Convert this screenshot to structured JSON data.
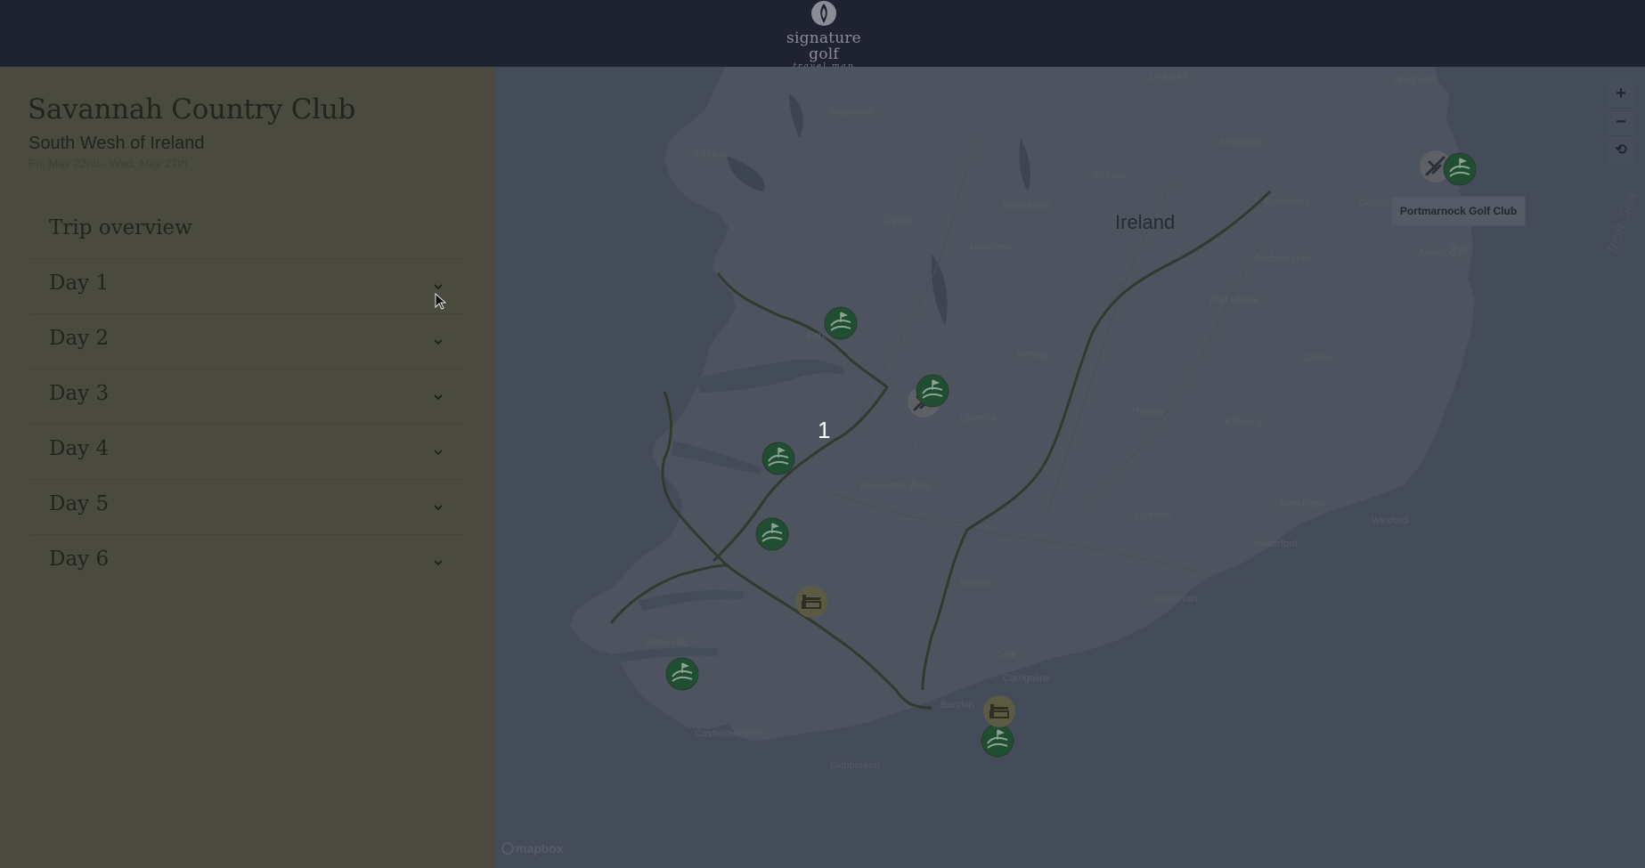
{
  "header": {
    "logo_word": "signature golf",
    "logo_sub": "travel map"
  },
  "sidebar": {
    "trip_title": "Savannah Country Club",
    "region": "South Wesh of Ireland",
    "dates": "Fri, May 22nd - Wed, May 27th",
    "items": [
      {
        "label": "Trip overview"
      },
      {
        "label": "Day 1"
      },
      {
        "label": "Day 2"
      },
      {
        "label": "Day 3"
      },
      {
        "label": "Day 4"
      },
      {
        "label": "Day 5"
      },
      {
        "label": "Day 6"
      }
    ]
  },
  "map": {
    "country_label": "Ireland",
    "cluster_number": "1",
    "tooltip": "Portmarnock Golf Club",
    "attribution": "mapbox",
    "controls": {
      "zoom_in": "+",
      "zoom_out": "−",
      "reset": "⟲"
    },
    "place_labels": [
      "Longford",
      "Drogheda",
      "Ballinrobe",
      "Clifden",
      "Mullingar",
      "Athlone",
      "Ballinasloe",
      "Galway",
      "Loughrea",
      "Edenderry",
      "Celbridge",
      "Portarlington",
      "Newbridge",
      "Bray",
      "Port Laoise",
      "Ennis",
      "Nenagh",
      "Carlow",
      "Limerick",
      "Thurles",
      "Kilkenny",
      "Newcastle West",
      "Clonmel",
      "New Ross",
      "Wexford",
      "Waterford",
      "Mallow",
      "Dungarvan",
      "Cork",
      "Carrigaline",
      "Bandon",
      "Skibbereen",
      "Castletownbere",
      "Waterville"
    ],
    "marker_colors": {
      "golf": "#1f4e33",
      "hotel": "#5b5a42",
      "airport": "#5e6066",
      "route": "#33392e"
    }
  }
}
